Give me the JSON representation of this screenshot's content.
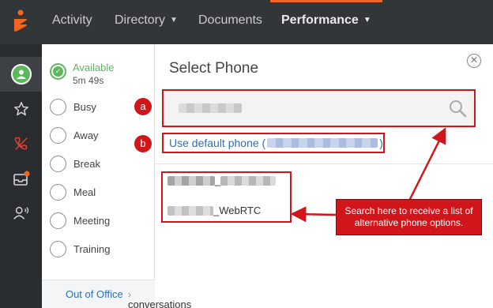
{
  "nav": {
    "activity": "Activity",
    "directory": "Directory",
    "documents": "Documents",
    "performance": "Performance"
  },
  "status": {
    "available_label": "Available",
    "available_time": "5m 49s",
    "options": [
      "Busy",
      "Away",
      "Break",
      "Meal",
      "Meeting",
      "Training"
    ],
    "out_of_office": "Out of Office"
  },
  "select_phone": {
    "title": "Select Phone",
    "default_phone_prefix": "Use default phone (",
    "default_phone_suffix": ")",
    "items": [
      {
        "suffix": "_"
      },
      {
        "suffix": "_WebRTC"
      }
    ]
  },
  "annotations": {
    "badge_a": "a",
    "badge_b": "b",
    "callout_text": "Search here to receive a list of alternative phone options."
  },
  "background_text": "conversations",
  "colors": {
    "accent_orange": "#f26522",
    "status_green": "#5cb85c",
    "link_blue": "#2f6fb5",
    "annotation_red": "#d0161b",
    "nav_bg": "#333639"
  }
}
